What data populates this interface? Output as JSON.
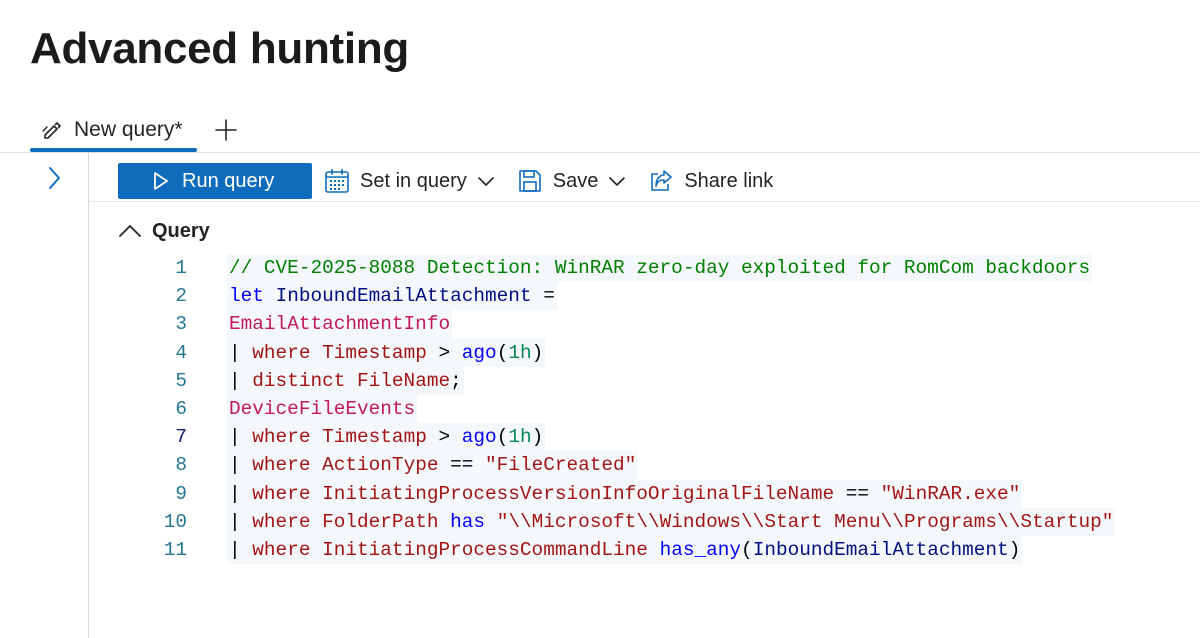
{
  "page": {
    "title": "Advanced hunting"
  },
  "tabs": [
    {
      "label": "New query*",
      "icon": "edit-icon",
      "active": true
    }
  ],
  "add_tab": {
    "icon": "plus-icon"
  },
  "rail": {
    "toggle_icon": "chevron-right-icon"
  },
  "toolbar": {
    "run_label": "Run query",
    "set_in_query_label": "Set in query",
    "save_label": "Save",
    "share_label": "Share link"
  },
  "query": {
    "section_label": "Query",
    "lines": [
      {
        "num": "1",
        "tokens": [
          {
            "t": "// CVE-2025-8088 Detection: WinRAR zero-day exploited for RomCom backdoors",
            "c": "comment"
          }
        ]
      },
      {
        "num": "2",
        "tokens": [
          {
            "t": "let",
            "c": "kw"
          },
          {
            "t": " ",
            "c": "plain"
          },
          {
            "t": "InboundEmailAttachment",
            "c": "ident"
          },
          {
            "t": " =",
            "c": "plain"
          }
        ]
      },
      {
        "num": "3",
        "tokens": [
          {
            "t": "EmailAttachmentInfo",
            "c": "table"
          }
        ]
      },
      {
        "num": "4",
        "tokens": [
          {
            "t": "| ",
            "c": "pipe"
          },
          {
            "t": "where",
            "c": "op"
          },
          {
            "t": " ",
            "c": "plain"
          },
          {
            "t": "Timestamp",
            "c": "col"
          },
          {
            "t": " > ",
            "c": "plain"
          },
          {
            "t": "ago",
            "c": "func"
          },
          {
            "t": "(",
            "c": "plain"
          },
          {
            "t": "1h",
            "c": "num"
          },
          {
            "t": ")",
            "c": "plain"
          }
        ]
      },
      {
        "num": "5",
        "tokens": [
          {
            "t": "| ",
            "c": "pipe"
          },
          {
            "t": "distinct",
            "c": "op"
          },
          {
            "t": " ",
            "c": "plain"
          },
          {
            "t": "FileName",
            "c": "col"
          },
          {
            "t": ";",
            "c": "plain"
          }
        ]
      },
      {
        "num": "6",
        "tokens": [
          {
            "t": "DeviceFileEvents",
            "c": "table"
          }
        ]
      },
      {
        "num": "7",
        "current": true,
        "tokens": [
          {
            "t": "| ",
            "c": "pipe"
          },
          {
            "t": "where",
            "c": "op"
          },
          {
            "t": " ",
            "c": "plain"
          },
          {
            "t": "Timestamp",
            "c": "col"
          },
          {
            "t": " > ",
            "c": "plain"
          },
          {
            "t": "ago",
            "c": "func"
          },
          {
            "t": "(",
            "c": "plain"
          },
          {
            "t": "1h",
            "c": "num"
          },
          {
            "t": ")",
            "c": "plain"
          }
        ]
      },
      {
        "num": "8",
        "tokens": [
          {
            "t": "| ",
            "c": "pipe"
          },
          {
            "t": "where",
            "c": "op"
          },
          {
            "t": " ",
            "c": "plain"
          },
          {
            "t": "ActionType",
            "c": "col"
          },
          {
            "t": " == ",
            "c": "plain"
          },
          {
            "t": "\"FileCreated\"",
            "c": "str"
          }
        ]
      },
      {
        "num": "9",
        "tokens": [
          {
            "t": "| ",
            "c": "pipe"
          },
          {
            "t": "where",
            "c": "op"
          },
          {
            "t": " ",
            "c": "plain"
          },
          {
            "t": "InitiatingProcessVersionInfoOriginalFileName",
            "c": "col"
          },
          {
            "t": " == ",
            "c": "plain"
          },
          {
            "t": "\"WinRAR.exe\"",
            "c": "str"
          }
        ]
      },
      {
        "num": "10",
        "tokens": [
          {
            "t": "| ",
            "c": "pipe"
          },
          {
            "t": "where",
            "c": "op"
          },
          {
            "t": " ",
            "c": "plain"
          },
          {
            "t": "FolderPath",
            "c": "col"
          },
          {
            "t": " ",
            "c": "plain"
          },
          {
            "t": "has",
            "c": "kw"
          },
          {
            "t": " ",
            "c": "plain"
          },
          {
            "t": "\"\\\\Microsoft\\\\Windows\\\\Start Menu\\\\Programs\\\\Startup\"",
            "c": "str"
          }
        ]
      },
      {
        "num": "11",
        "tokens": [
          {
            "t": "| ",
            "c": "pipe"
          },
          {
            "t": "where",
            "c": "op"
          },
          {
            "t": " ",
            "c": "plain"
          },
          {
            "t": "InitiatingProcessCommandLine",
            "c": "col"
          },
          {
            "t": " ",
            "c": "plain"
          },
          {
            "t": "has_any",
            "c": "kw"
          },
          {
            "t": "(",
            "c": "plain"
          },
          {
            "t": "InboundEmailAttachment",
            "c": "ident"
          },
          {
            "t": ")",
            "c": "plain"
          }
        ]
      }
    ]
  },
  "colors": {
    "accent": "#0f6cbd",
    "comment": "#008000",
    "keyword": "#0000ff",
    "table": "#c2185b",
    "operator": "#a31515",
    "line_number": "#237893"
  }
}
